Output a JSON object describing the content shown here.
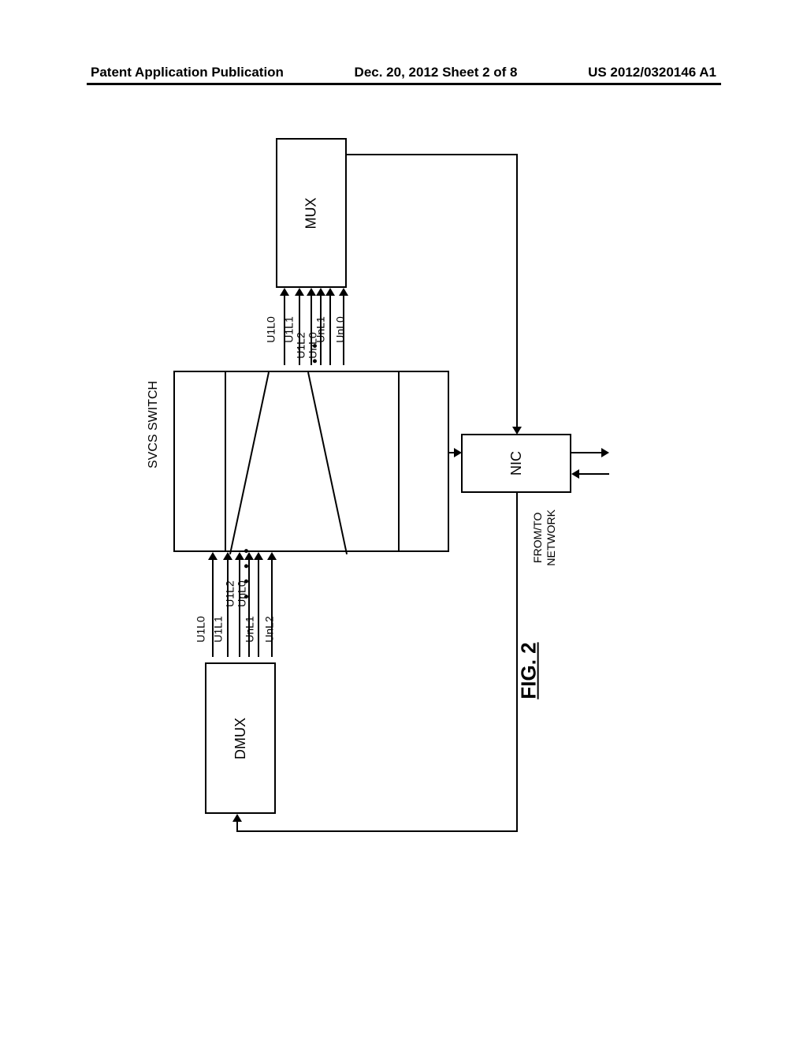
{
  "header": {
    "left": "Patent Application Publication",
    "center": "Dec. 20, 2012  Sheet 2 of 8",
    "right": "US 2012/0320146 A1"
  },
  "blocks": {
    "mux": "MUX",
    "switch": "SVCS  SWITCH",
    "dmux": "DMUX",
    "nic": "NIC"
  },
  "signals_top": {
    "u1l0": "U1L0",
    "u1l1": "U1L1",
    "u1l2": "U1L2",
    "unl0_inner": "UnL0",
    "unl1": "UnL1",
    "unl0": "UnL0"
  },
  "signals_bottom": {
    "u1l0": "U1L0",
    "u1l1": "U1L1",
    "u1l2": "U1L2",
    "unl0_inner": "UnL0",
    "unl1": "UnL1",
    "unl2": "UnL2"
  },
  "network_label": "FROM/TO\nNETWORK",
  "figure_label": "FIG. 2",
  "dots": "• • • •"
}
